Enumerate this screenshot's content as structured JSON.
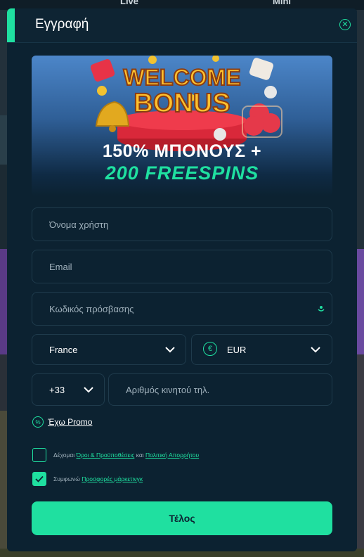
{
  "background": {
    "nav_items": [
      "Live",
      "Mini"
    ]
  },
  "modal": {
    "title": "Εγγραφή",
    "close_icon": "close-icon"
  },
  "banner": {
    "headline_1": "WELCOME",
    "headline_2": "BONUS",
    "offer_line_1": "150% ΜΠΟΝΟΥΣ +",
    "offer_line_2": "200 FREESPINS"
  },
  "form": {
    "username_placeholder": "Όνομα χρήστη",
    "email_placeholder": "Email",
    "password_placeholder": "Κωδικός πρόσβασης",
    "country_value": "France",
    "currency_value": "EUR",
    "currency_icon": "euro-icon",
    "phone_code_value": "+33",
    "phone_placeholder": "Αριθμός κινητού τηλ.",
    "promo_label": "Έχω Promo",
    "terms": {
      "prefix": "Δέχομαι",
      "link_1": "Όροι & Προϋποθέσεις",
      "middle": "και",
      "link_2": "Πολιτική Απορρήτου",
      "checked": false
    },
    "marketing": {
      "prefix": "Συμφωνώ",
      "link": "Προσφορές μάρκετινγκ",
      "checked": true
    },
    "submit_label": "Τέλος"
  },
  "colors": {
    "accent": "#1fe0a0",
    "modal_bg": "#0c2231",
    "field_border": "#1f3b4c"
  }
}
